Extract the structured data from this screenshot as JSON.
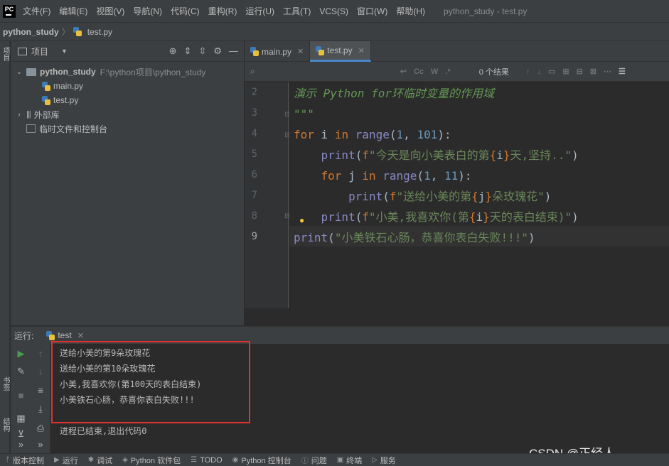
{
  "menubar": {
    "logo_text": "PC",
    "items": [
      "文件(F)",
      "编辑(E)",
      "视图(V)",
      "导航(N)",
      "代码(C)",
      "重构(R)",
      "运行(U)",
      "工具(T)",
      "VCS(S)",
      "窗口(W)",
      "帮助(H)"
    ],
    "window_title": "python_study - test.py"
  },
  "navbar": {
    "project": "python_study",
    "file": "test.py"
  },
  "left_strip": {
    "project_tab": "项目",
    "bookmarks_tab": "书签",
    "structure_tab": "结构"
  },
  "project_panel": {
    "title": "项目",
    "root_name": "python_study",
    "root_path": "F:\\python项目\\python_study",
    "files": [
      "main.py",
      "test.py"
    ],
    "external_libs": "外部库",
    "scratches": "临时文件和控制台"
  },
  "editor": {
    "tabs": [
      {
        "label": "main.py",
        "active": false
      },
      {
        "label": "test.py",
        "active": true
      }
    ],
    "search": {
      "placeholder": "",
      "count_label": "0 个结果",
      "btn_cc": "Cc",
      "btn_w": "W",
      "btn_regex": ".*"
    },
    "line_numbers": [
      "2",
      "3",
      "4",
      "5",
      "6",
      "7",
      "8",
      "9"
    ],
    "current_line": "9"
  },
  "run_panel": {
    "label": "运行:",
    "tab": "test",
    "output": [
      "送给小美的第9朵玫瑰花",
      "送给小美的第10朵玫瑰花",
      "小美,我喜欢你(第100天的表白结束)",
      "小美铁石心肠，恭喜你表白失败!!!",
      "进程已结束,退出代码0"
    ]
  },
  "statusbar": {
    "items": [
      "版本控制",
      "运行",
      "调试",
      "Python 软件包",
      "TODO",
      "Python 控制台",
      "问题",
      "终端",
      "服务"
    ]
  },
  "watermark": "CSDN @正经人_____",
  "colors": {
    "accent": "#4a88c7",
    "highlight_box": "#e03131",
    "keyword": "#cc7832",
    "string": "#6a8759",
    "number": "#6897bb",
    "builtin": "#8888c6"
  }
}
